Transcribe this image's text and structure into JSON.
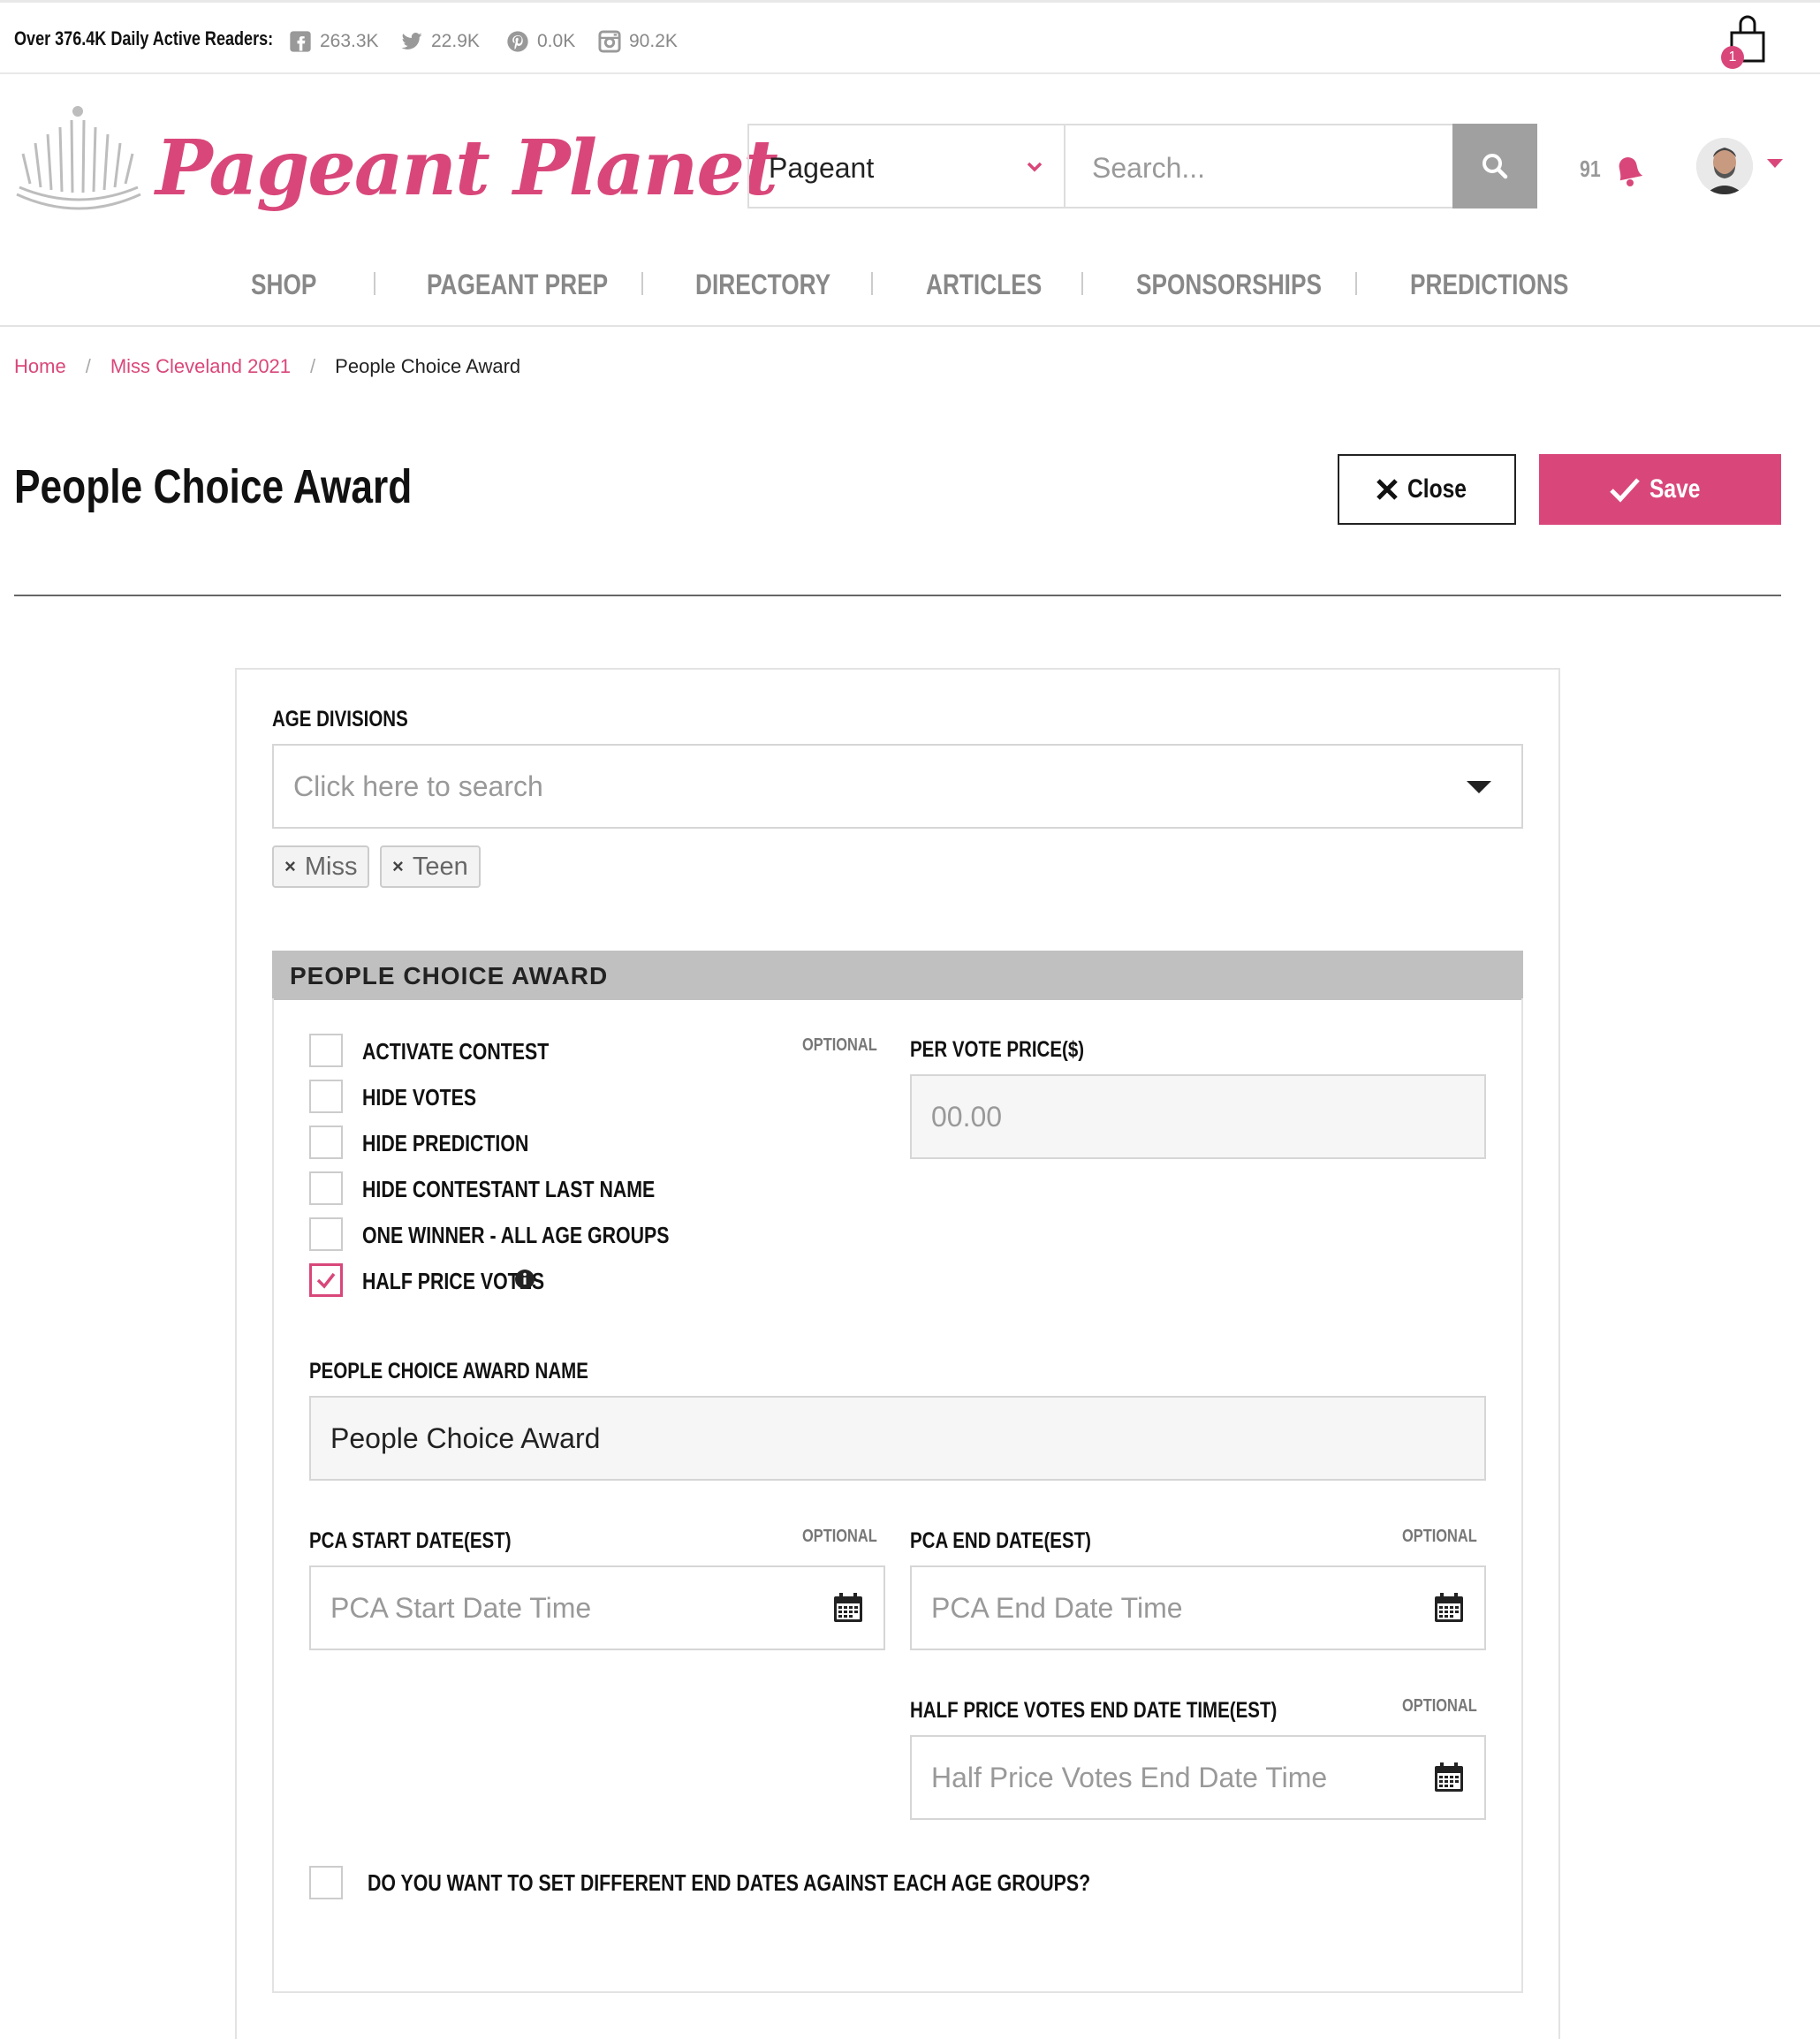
{
  "topbar": {
    "readers": "Over 376.4K Daily Active Readers:",
    "facebook": "263.3K",
    "twitter": "22.9K",
    "pinterest": "0.0K",
    "instagram": "90.2K",
    "cart_count": "1"
  },
  "header": {
    "logo_text": "Pageant Planet",
    "category_select": "Pageant",
    "search_placeholder": "Search...",
    "notification_count": "91"
  },
  "nav": [
    "SHOP",
    "PAGEANT PREP",
    "DIRECTORY",
    "ARTICLES",
    "SPONSORSHIPS",
    "PREDICTIONS"
  ],
  "breadcrumb": [
    "Home",
    "Miss Cleveland 2021",
    "People Choice Award"
  ],
  "page": {
    "title": "People Choice Award",
    "close_label": "Close",
    "save_label": "Save"
  },
  "form": {
    "age_divisions_label": "AGE DIVISIONS",
    "age_divisions_placeholder": "Click here to search",
    "selected_tags": [
      "Miss",
      "Teen"
    ],
    "section_title": "PEOPLE CHOICE AWARD",
    "options": [
      {
        "label": "ACTIVATE CONTEST",
        "checked": false
      },
      {
        "label": "HIDE VOTES",
        "checked": false
      },
      {
        "label": "HIDE PREDICTION",
        "checked": false
      },
      {
        "label": "HIDE CONTESTANT LAST NAME",
        "checked": false
      },
      {
        "label": "ONE WINNER - ALL AGE GROUPS",
        "checked": false
      },
      {
        "label": "HALF PRICE VOTES",
        "checked": true
      }
    ],
    "optional_text": "OPTIONAL",
    "per_vote_price_label": "PER VOTE PRICE($)",
    "per_vote_price_placeholder": "00.00",
    "award_name_label": "PEOPLE CHOICE AWARD NAME",
    "award_name_value": "People Choice Award",
    "start_date_label": "PCA START DATE(EST)",
    "start_date_placeholder": "PCA Start Date Time",
    "end_date_label": "PCA END DATE(EST)",
    "end_date_placeholder": "PCA End Date Time",
    "half_price_end_label": "HALF PRICE VOTES END DATE TIME(EST)",
    "half_price_end_placeholder": "Half Price Votes End Date Time",
    "different_end_dates_label": "DO YOU WANT TO SET DIFFERENT END DATES AGAINST EACH AGE GROUPS?",
    "different_end_dates_checked": false
  },
  "colors": {
    "accent": "#d9477a",
    "gray_button": "#a0a0a0",
    "section_header": "#c0c0c0"
  }
}
